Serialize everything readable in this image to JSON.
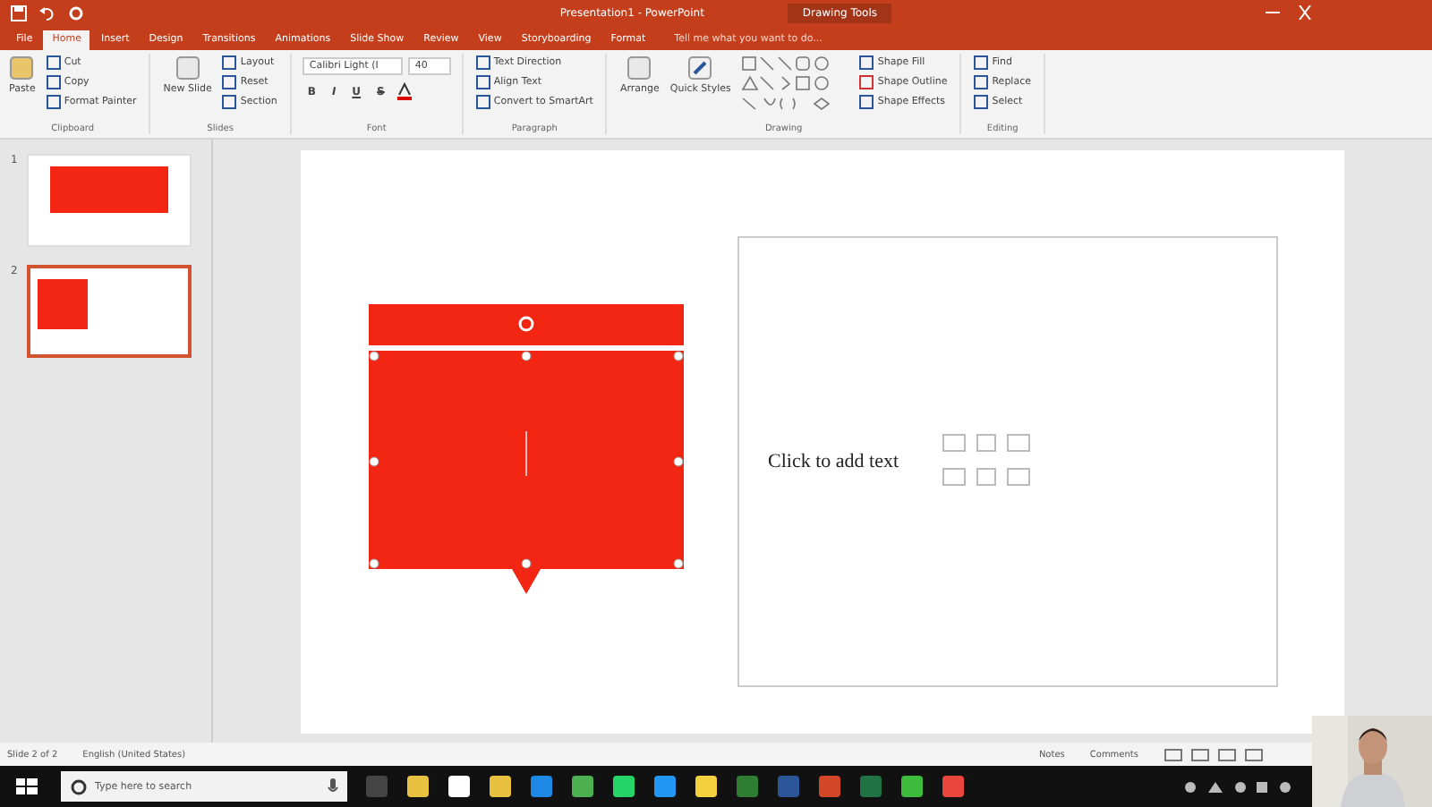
{
  "window": {
    "title": "Presentation1 - PowerPoint",
    "context_tab": "Drawing Tools"
  },
  "tabs": [
    {
      "label": "File",
      "selected": false
    },
    {
      "label": "Home",
      "selected": true
    },
    {
      "label": "Insert",
      "selected": false
    },
    {
      "label": "Design",
      "selected": false
    },
    {
      "label": "Transitions",
      "selected": false
    },
    {
      "label": "Animations",
      "selected": false
    },
    {
      "label": "Slide Show",
      "selected": false
    },
    {
      "label": "Review",
      "selected": false
    },
    {
      "label": "View",
      "selected": false
    },
    {
      "label": "Storyboarding",
      "selected": false
    },
    {
      "label": "Format",
      "selected": false
    }
  ],
  "tell_me": {
    "placeholder": "Tell me what you want to do..."
  },
  "ribbon": [
    {
      "name": "Clipboard",
      "big": "Paste",
      "items": [
        "Cut",
        "Copy",
        "Format Painter"
      ]
    },
    {
      "name": "Slides",
      "big": "New Slide",
      "items": [
        "Layout",
        "Reset",
        "Section"
      ]
    },
    {
      "name": "Font",
      "font": "Calibri Light (I",
      "size": "40",
      "items": [
        "B",
        "I",
        "U",
        "S"
      ]
    },
    {
      "name": "Paragraph",
      "items": [
        "Text Direction",
        "Align Text",
        "Convert to SmartArt"
      ]
    },
    {
      "name": "Drawing",
      "big": "Arrange",
      "big2": "Quick Styles",
      "items": [
        "Shape Fill",
        "Shape Outline",
        "Shape Effects"
      ]
    },
    {
      "name": "Editing",
      "items": [
        "Find",
        "Replace",
        "Select"
      ]
    }
  ],
  "slides": [
    {
      "number": "1",
      "selected": false
    },
    {
      "number": "2",
      "selected": true
    }
  ],
  "placeholder_text": "Click to add text",
  "status_bar": {
    "slide": "Slide 2 of 2",
    "language": "English (United States)",
    "notes": "Notes",
    "comments": "Comments"
  },
  "taskbar": {
    "search": {
      "placeholder": "Type here to search"
    }
  }
}
